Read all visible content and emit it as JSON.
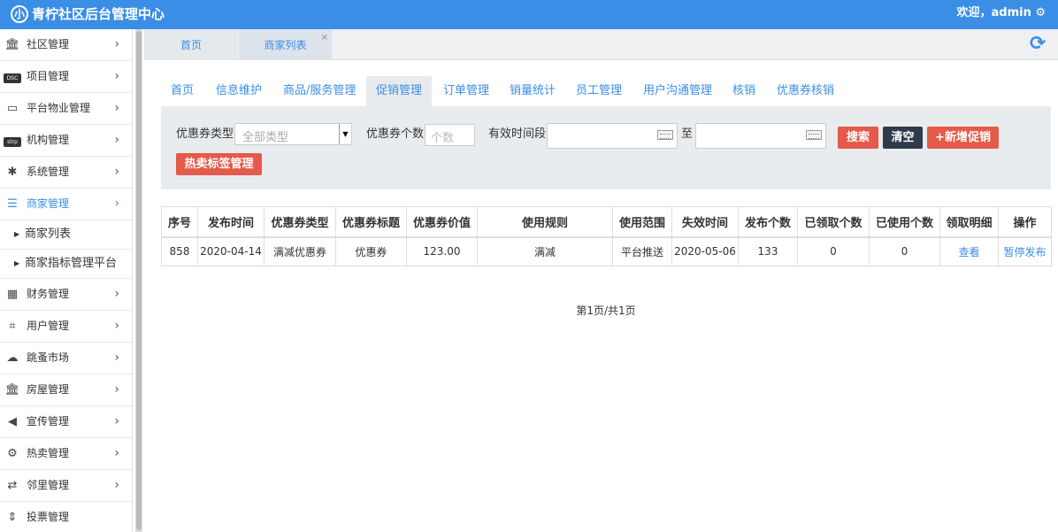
{
  "header": {
    "logo_glyph": "小",
    "title": "青柠社区后台管理中心",
    "welcome": "欢迎，admin ⚙"
  },
  "sidebar": {
    "items": [
      {
        "label": "社区管理",
        "icon": "bank-icon"
      },
      {
        "label": "项目管理",
        "icon": "discover-card-icon"
      },
      {
        "label": "平台物业管理",
        "icon": "monitor-icon"
      },
      {
        "label": "机构管理",
        "icon": "stripe-icon"
      },
      {
        "label": "系统管理",
        "icon": "slack-icon"
      },
      {
        "label": "商家管理",
        "icon": "bars-icon"
      },
      {
        "label": "财务管理",
        "icon": "calculator-icon"
      },
      {
        "label": "用户管理",
        "icon": "crop-icon"
      },
      {
        "label": "跳蚤市场",
        "icon": "cloud-icon"
      },
      {
        "label": "房屋管理",
        "icon": "bank-icon"
      },
      {
        "label": "宣传管理",
        "icon": "volume-icon"
      },
      {
        "label": "热卖管理",
        "icon": "gear-icon"
      },
      {
        "label": "邻里管理",
        "icon": "retweet-icon"
      },
      {
        "label": "投票管理",
        "icon": "sort-icon"
      }
    ],
    "sub_items": [
      {
        "label": "商家列表"
      },
      {
        "label": "商家指标管理平台"
      }
    ],
    "active_color": "#3a8ee6"
  },
  "page_tabs": {
    "home": "首页",
    "current": "商家列表",
    "close": "×"
  },
  "subnav": [
    "首页",
    "信息维护",
    "商品/服务管理",
    "促销管理",
    "订单管理",
    "销量统计",
    "员工管理",
    "用户沟通管理",
    "核销",
    "优惠券核销"
  ],
  "filter": {
    "type_label": "优惠券类型:",
    "type_value": "全部类型",
    "count_label": "优惠券个数:",
    "count_placeholder": "个数",
    "period_label": "有效时间段",
    "to_label": "至",
    "search_btn": "搜索",
    "clear_btn": "清空",
    "add_btn": "+新增促销",
    "hot_tag_btn": "热卖标签管理"
  },
  "table": {
    "headers": [
      "序号",
      "发布时间",
      "优惠券类型",
      "优惠券标题",
      "优惠券价值",
      "使用规则",
      "使用范围",
      "失效时间",
      "发布个数",
      "已领取个数",
      "已使用个数",
      "领取明细",
      "操作"
    ],
    "rows": [
      [
        "858",
        "2020-04-14",
        "满减优惠券",
        "优惠券",
        "123.00",
        "满减",
        "平台推送",
        "2020-05-06",
        "133",
        "0",
        "0",
        "查看",
        "暂停发布"
      ]
    ]
  },
  "pager": "第1页/共1页",
  "colors": {
    "header_bg": "#3a8ee6",
    "link": "#3a8ee6",
    "danger": "#e45a4b",
    "dark": "#2f3b4a"
  }
}
